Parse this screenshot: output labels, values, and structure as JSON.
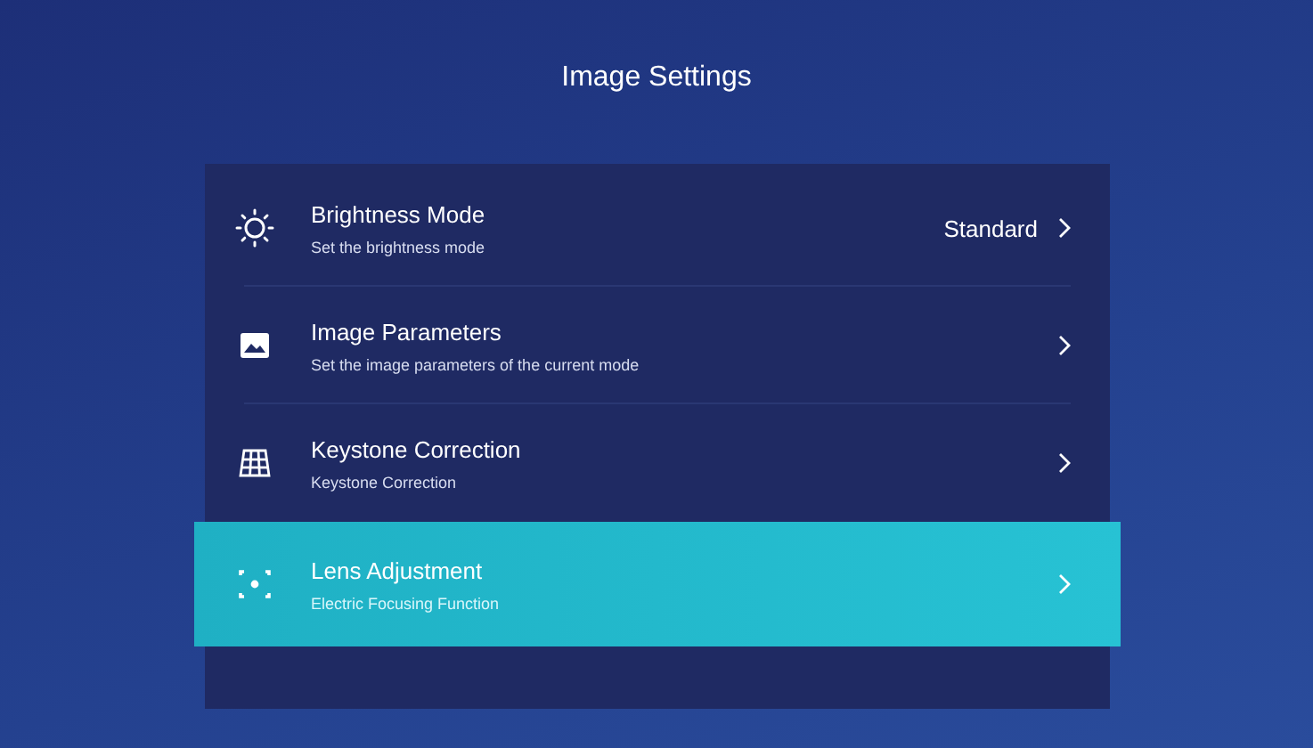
{
  "window": {
    "title": "Image Settings"
  },
  "items": [
    {
      "kind": "sun",
      "title": "Brightness Mode",
      "subtitle": "Set the brightness mode",
      "value": "Standard",
      "selected": false
    },
    {
      "kind": "picture",
      "title": "Image Parameters",
      "subtitle": "Set the image parameters of the current mode",
      "selected": false
    },
    {
      "kind": "grid",
      "title": "Keystone Correction",
      "subtitle": "Keystone Correction",
      "selected": false
    },
    {
      "kind": "focus",
      "title": "Lens Adjustment",
      "subtitle": "Electric Focusing Function",
      "selected": true
    }
  ]
}
